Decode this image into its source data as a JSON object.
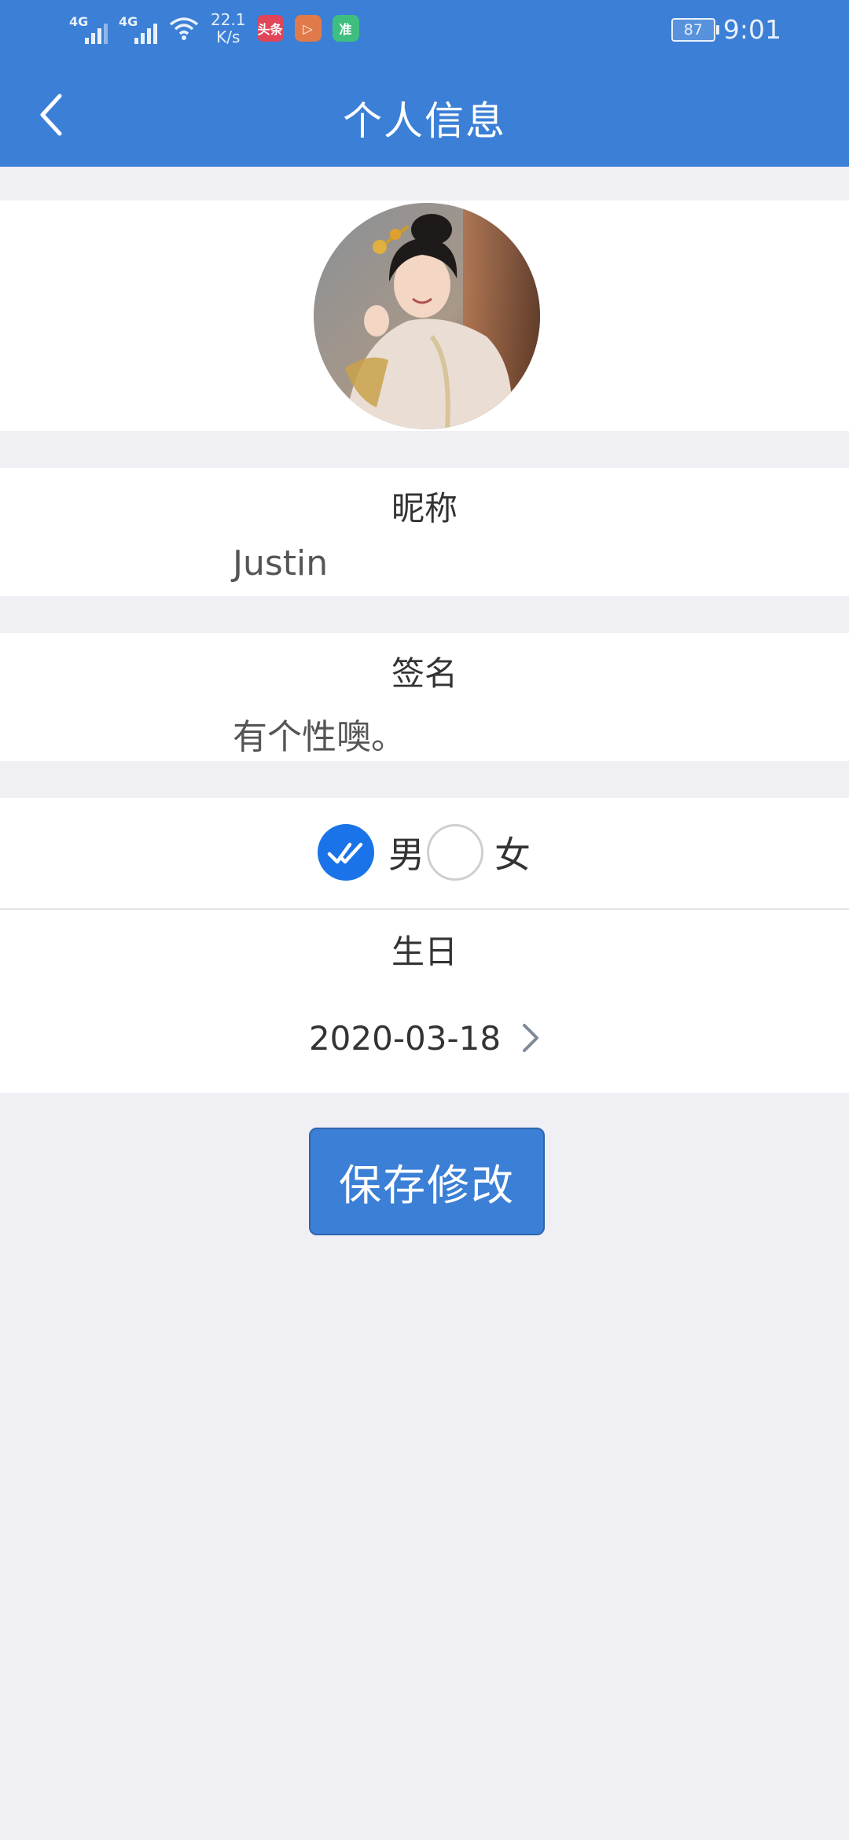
{
  "status_bar": {
    "network1": "4G",
    "network2": "4G",
    "speed_value": "22.1",
    "speed_unit": "K/s",
    "app_icons": [
      {
        "name": "toutiao",
        "label": "头条",
        "color": "#e0455a"
      },
      {
        "name": "video",
        "label": "▷",
        "color": "#e07a4a"
      },
      {
        "name": "zhun",
        "label": "准",
        "color": "#3fbf7f"
      }
    ],
    "battery": "87",
    "time": "9:01"
  },
  "header": {
    "title": "个人信息"
  },
  "profile": {
    "nickname_label": "昵称",
    "nickname": "Justin",
    "signature_label": "签名",
    "signature": "有个性噢。",
    "gender_options": [
      {
        "label": "男",
        "selected": true
      },
      {
        "label": "女",
        "selected": false
      }
    ],
    "birthday_label": "生日",
    "birthday": "2020-03-18"
  },
  "actions": {
    "save_label": "保存修改"
  },
  "colors": {
    "primary": "#3b7fd6",
    "radio_checked": "#1a73e8",
    "page_bg": "#efeff4"
  }
}
